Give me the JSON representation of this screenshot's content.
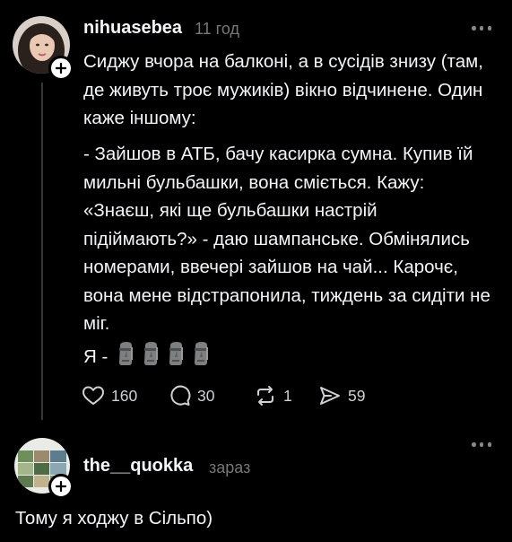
{
  "post": {
    "username": "nihuasebea",
    "time": "11 год",
    "paragraphs": [
      "Сиджу вчора на балконі, а в сусідів знизу (там, де живуть троє мужиків) вікно відчинене. Один каже іншому:",
      "- Зайшов в АТБ, бачу касирка сумна. Купив їй мильні бульбашки, вона сміється. Кажу: «Знаєш, які ще бульбашки настрій підіймають?» - даю шампанське. Обмінялись номерами, ввечері зайшов на чай... Карочє, вона мене відстрапонила, тиждень за сидіти не міг."
    ],
    "last_line_prefix": "Я -",
    "last_line_emoji": [
      "moai-emoji",
      "moai-emoji",
      "moai-emoji",
      "moai-emoji"
    ],
    "actions": {
      "likes": "160",
      "comments": "30",
      "reposts": "1",
      "shares": "59"
    }
  },
  "reply": {
    "username": "the__quokka",
    "time": "зараз",
    "text": "Тому я ходжу в Сільпо)"
  },
  "icons": {
    "like": "heart-icon",
    "comment": "comment-bubble-icon",
    "repost": "repost-icon",
    "share": "send-icon",
    "more": "more-dots-icon",
    "follow": "plus-icon"
  },
  "colors": {
    "background": "#000000",
    "text": "#f3f5f7",
    "secondary": "#777777",
    "thread_line": "#333638"
  }
}
